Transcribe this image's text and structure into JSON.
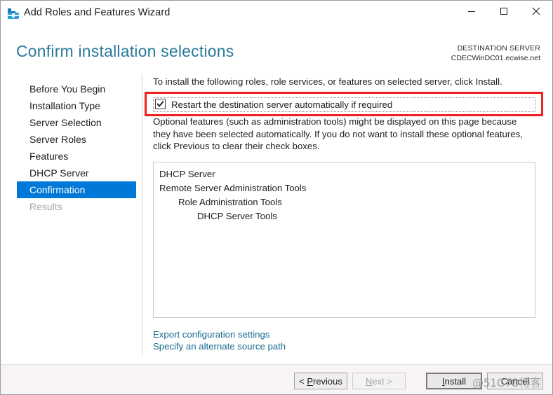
{
  "window": {
    "title": "Add Roles and Features Wizard",
    "icon": "toolbox-icon",
    "accent_color": "#f25022",
    "controls": {
      "minimize": "minimize-icon",
      "maximize": "maximize-icon",
      "close": "close-icon"
    }
  },
  "header": {
    "page_title": "Confirm installation selections",
    "title_color": "#2a7a9b",
    "destination_label": "DESTINATION SERVER",
    "destination_value": "CDECWinDC01.ecwise.net"
  },
  "sidebar": {
    "selected_color": "#0078d7",
    "items": [
      {
        "label": "Before You Begin",
        "state": "normal"
      },
      {
        "label": "Installation Type",
        "state": "normal"
      },
      {
        "label": "Server Selection",
        "state": "normal"
      },
      {
        "label": "Server Roles",
        "state": "normal"
      },
      {
        "label": "Features",
        "state": "normal"
      },
      {
        "label": "DHCP Server",
        "state": "normal"
      },
      {
        "label": "Confirmation",
        "state": "selected"
      },
      {
        "label": "Results",
        "state": "disabled"
      }
    ]
  },
  "content": {
    "instruction": "To install the following roles, role services, or features on selected server, click Install.",
    "restart_checkbox": {
      "label": "Restart the destination server automatically if required",
      "checked": true,
      "focused": true
    },
    "optional_note": "Optional features (such as administration tools) might be displayed on this page because they have been selected automatically. If you do not want to install these optional features, click Previous to clear their check boxes.",
    "selection_list": [
      {
        "label": "DHCP Server",
        "level": 0
      },
      {
        "label": "Remote Server Administration Tools",
        "level": 0
      },
      {
        "label": "Role Administration Tools",
        "level": 1
      },
      {
        "label": "DHCP Server Tools",
        "level": 2
      }
    ],
    "links": [
      {
        "label": "Export configuration settings"
      },
      {
        "label": "Specify an alternate source path"
      }
    ],
    "annotation_color": "#ef2020"
  },
  "footer": {
    "buttons": {
      "previous": "< Previous",
      "next": "Next >",
      "install": "Install",
      "cancel": "Cancel"
    }
  },
  "watermark": "@51CTO博客"
}
